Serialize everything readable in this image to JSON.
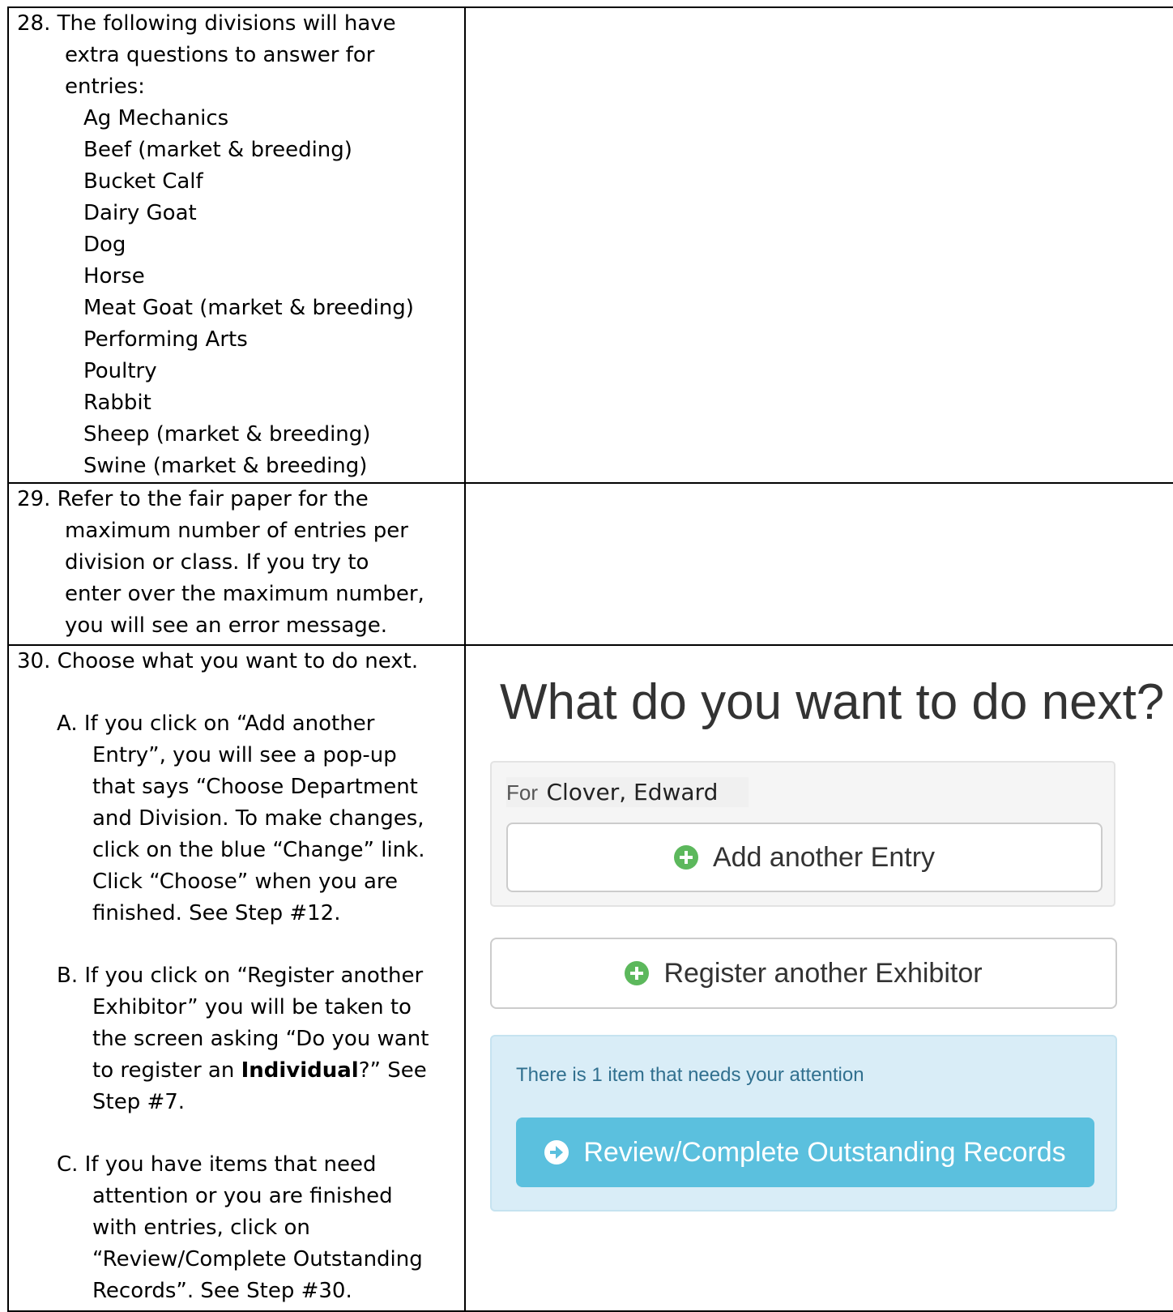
{
  "step28": {
    "head": "28. The following divisions will have",
    "cont": [
      "extra questions to answer for",
      "entries:"
    ],
    "divisions": [
      "Ag Mechanics",
      "Beef (market & breeding)",
      "Bucket Calf",
      "Dairy Goat",
      "Dog",
      "Horse",
      "Meat Goat (market & breeding)",
      "Performing Arts",
      "Poultry",
      "Rabbit",
      "Sheep (market & breeding)",
      "Swine (market & breeding)"
    ]
  },
  "step29": {
    "head": "29.   Refer to the fair paper for the",
    "cont": [
      "maximum number of entries per",
      "division or class.  If you try to",
      "enter over the maximum number,",
      "you will see an error message."
    ]
  },
  "step30": {
    "head": "30.   Choose what you want to do next.",
    "a": {
      "first": "A.  If you click on “Add another",
      "cont": [
        "Entry”, you will see a pop-up",
        "that says “Choose Department",
        "and Division.  To make changes,",
        "click on the blue “Change” link.",
        "Click  “Choose” when you are",
        "finished.  See Step #12."
      ]
    },
    "b": {
      "first": "B.  If you click on “Register another",
      "cont1": "Exhibitor” you will be taken to",
      "cont2": "the screen asking “Do you want",
      "cont3_pre": "to register an ",
      "cont3_bold": "Individual",
      "cont3_post": "?”  See",
      "cont4": "Step #7."
    },
    "c": {
      "first": "C.  If you have items that need",
      "cont": [
        "attention or you are finished",
        "with entries, click on",
        "“Review/Complete Outstanding",
        "Records”.  See Step #30."
      ]
    }
  },
  "screenshot": {
    "heading": "What do you want to do next?",
    "for_label": "For",
    "for_name": "Clover, Edward",
    "add_entry_label": "Add another Entry",
    "register_label": "Register another Exhibitor",
    "alert_text": "There is 1 item that needs your attention",
    "review_label": "Review/Complete Outstanding Records",
    "icons": {
      "add": "plus-circle-icon",
      "review": "arrow-right-circle-icon"
    },
    "colors": {
      "success": "#5cb85c",
      "info": "#5bc0de",
      "alert_bg": "#d9edf7",
      "alert_text": "#31708f"
    }
  }
}
